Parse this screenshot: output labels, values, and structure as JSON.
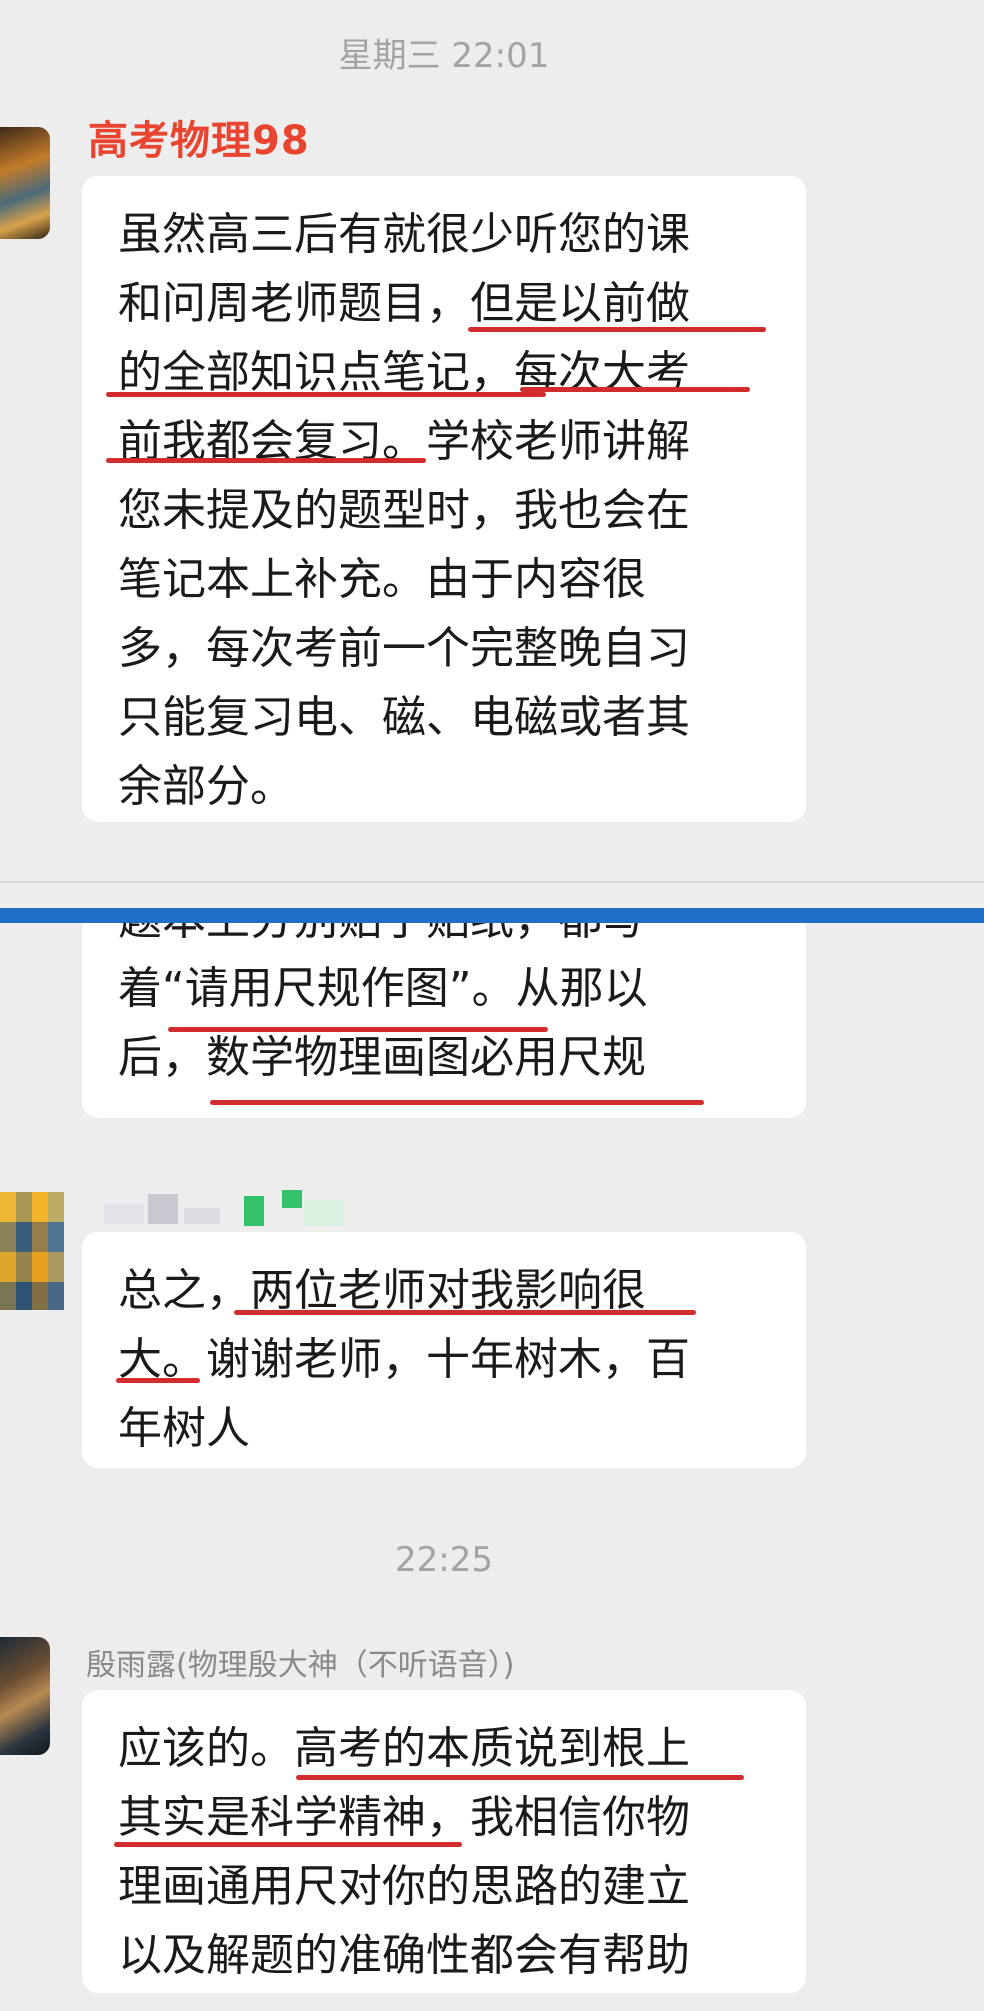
{
  "chat": {
    "timestamp_1": "星期三   22:01",
    "timestamp_2": "22:25",
    "msg1": {
      "sender": "高考物理98",
      "text": "虽然高三后有就很少听您的课\n和问周老师题目，但是以前做\n的全部知识点笔记，每次大考\n前我都会复习。学校老师讲解\n您未提及的题型时，我也会在\n笔记本上补充。由于内容很\n多，每次考前一个完整晚自习\n只能复习电、磁、电磁或者其\n余部分。"
    },
    "msg2": {
      "text": "题本上分别贴了贴纸，都写\n着“请用尺规作图”。从那以\n后，数学物理画图必用尺规"
    },
    "msg3": {
      "text": "总之，两位老师对我影响很\n大。谢谢老师，十年树木，百\n年树人"
    },
    "msg4": {
      "sender": "殷雨露(物理殷大神（不听语音）)",
      "text": "应该的。高考的本质说到根上\n其实是科学精神，我相信你物\n理画通用尺对你的思路的建立\n以及解题的准确性都会有帮助"
    }
  },
  "colors": {
    "background": "#ededed",
    "bubble": "#ffffff",
    "sender_accent": "#e8442f",
    "underline": "#d22c2c",
    "separator_bar": "#1f6fc6",
    "timestamp": "#a3a3a3"
  },
  "icons": [
    "avatar-image",
    "blurred-avatar-image"
  ]
}
